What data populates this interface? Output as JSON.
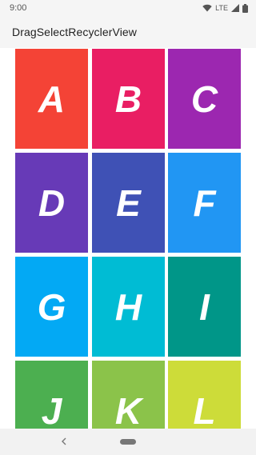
{
  "status_bar": {
    "time": "9:00",
    "network": "LTE",
    "icons": [
      "wifi-icon",
      "signal-icon",
      "battery-icon"
    ]
  },
  "app_bar": {
    "title": "DragSelectRecyclerView"
  },
  "grid": {
    "tiles": [
      {
        "letter": "A",
        "color": "#F44336"
      },
      {
        "letter": "B",
        "color": "#E91E63"
      },
      {
        "letter": "C",
        "color": "#9C27B0"
      },
      {
        "letter": "D",
        "color": "#673AB7"
      },
      {
        "letter": "E",
        "color": "#3F51B5"
      },
      {
        "letter": "F",
        "color": "#2196F3"
      },
      {
        "letter": "G",
        "color": "#03A9F4"
      },
      {
        "letter": "H",
        "color": "#00BCD4"
      },
      {
        "letter": "I",
        "color": "#009688"
      },
      {
        "letter": "J",
        "color": "#4CAF50"
      },
      {
        "letter": "K",
        "color": "#8BC34A"
      },
      {
        "letter": "L",
        "color": "#CDDC39"
      }
    ]
  },
  "nav_bar": {
    "icons": [
      "back-icon",
      "home-pill-icon"
    ]
  }
}
